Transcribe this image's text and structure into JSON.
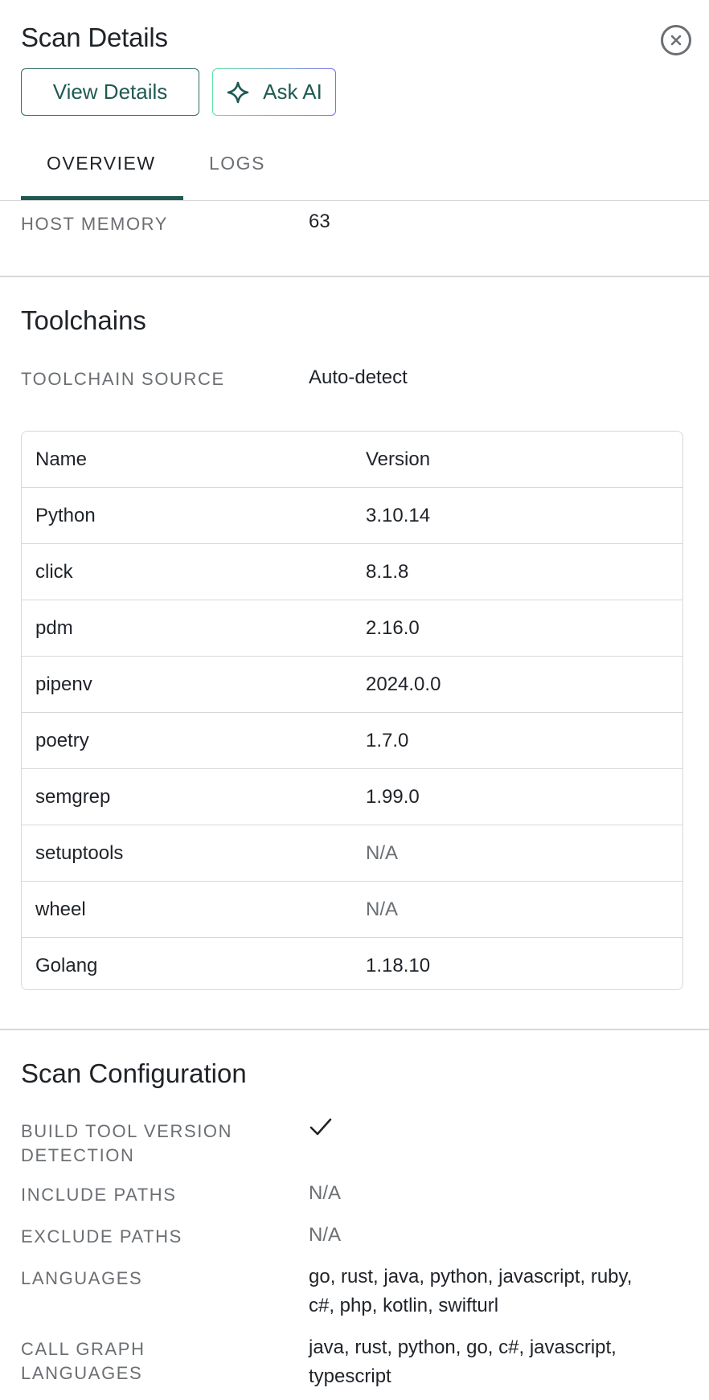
{
  "header": {
    "title": "Scan Details",
    "view_details_label": "View Details",
    "ask_ai_label": "Ask AI"
  },
  "tabs": [
    {
      "label": "OVERVIEW",
      "active": true
    },
    {
      "label": "LOGS",
      "active": false
    }
  ],
  "host": {
    "memory_label": "HOST MEMORY",
    "memory_value": "63"
  },
  "toolchains": {
    "title": "Toolchains",
    "source_label": "TOOLCHAIN SOURCE",
    "source_value": "Auto-detect",
    "columns": [
      "Name",
      "Version"
    ],
    "rows": [
      {
        "name": "Python",
        "version": "3.10.14"
      },
      {
        "name": "click",
        "version": "8.1.8"
      },
      {
        "name": "pdm",
        "version": "2.16.0"
      },
      {
        "name": "pipenv",
        "version": "2024.0.0"
      },
      {
        "name": "poetry",
        "version": "1.7.0"
      },
      {
        "name": "semgrep",
        "version": "1.99.0"
      },
      {
        "name": "setuptools",
        "version": "N/A"
      },
      {
        "name": "wheel",
        "version": "N/A"
      },
      {
        "name": "Golang",
        "version": "1.18.10"
      }
    ]
  },
  "scan_config": {
    "title": "Scan Configuration",
    "build_tool_label_line1": "BUILD TOOL VERSION",
    "build_tool_label_line2": "DETECTION",
    "build_tool_value": true,
    "include_paths_label": "INCLUDE PATHS",
    "include_paths_value": "N/A",
    "exclude_paths_label": "EXCLUDE PATHS",
    "exclude_paths_value": "N/A",
    "languages_label": "LANGUAGES",
    "languages_line1": "go, rust, java, python, javascript, ruby,",
    "languages_line2": "c#, php, kotlin, swifturl",
    "call_graph_label_line1": "CALL GRAPH",
    "call_graph_label_line2": "LANGUAGES",
    "call_graph_line1": "java, rust, python, go, c#, javascript,",
    "call_graph_line2": "typescript"
  },
  "icons": {
    "close": "close-circle-icon",
    "ai": "diamond-sparkle-icon",
    "check": "check-icon"
  },
  "colors": {
    "accent": "#1e5a52",
    "muted": "#6b6f73",
    "border": "#d6d8da",
    "ai_gradient_start": "#5ce0a0",
    "ai_gradient_end": "#7e6cf0"
  }
}
